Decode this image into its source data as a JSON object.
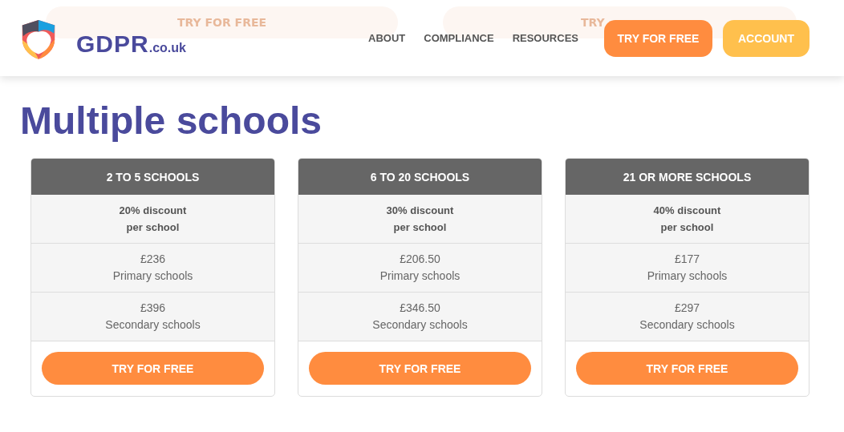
{
  "header": {
    "logo": {
      "name": "GDPR",
      "suffix": ".co.uk"
    },
    "faded_buttons": [
      "TRY FOR FREE",
      "TRY"
    ],
    "nav": [
      "ABOUT",
      "COMPLIANCE",
      "RESOURCES"
    ],
    "buttons": [
      {
        "label": "TRY FOR FREE",
        "kind": "primary"
      },
      {
        "label": "ACCOUNT",
        "kind": "secondary"
      }
    ]
  },
  "heading": "Multiple schools",
  "plans": [
    {
      "title": "2 TO 5 SCHOOLS",
      "discount": [
        "20% discount",
        "per school"
      ],
      "prices": [
        {
          "price": "£236",
          "label": "Primary schools"
        },
        {
          "price": "£396",
          "label": "Secondary schools"
        }
      ],
      "button": "TRY FOR FREE"
    },
    {
      "title": "6 TO 20 SCHOOLS",
      "discount": [
        "30% discount",
        "per school"
      ],
      "prices": [
        {
          "price": "£206.50",
          "label": "Primary schools"
        },
        {
          "price": "£346.50",
          "label": "Secondary schools"
        }
      ],
      "button": "TRY FOR FREE"
    },
    {
      "title": "21 OR MORE SCHOOLS",
      "discount": [
        "40% discount",
        "per school"
      ],
      "prices": [
        {
          "price": "£177",
          "label": "Primary schools"
        },
        {
          "price": "£297",
          "label": "Secondary schools"
        }
      ],
      "button": "TRY FOR FREE"
    }
  ]
}
